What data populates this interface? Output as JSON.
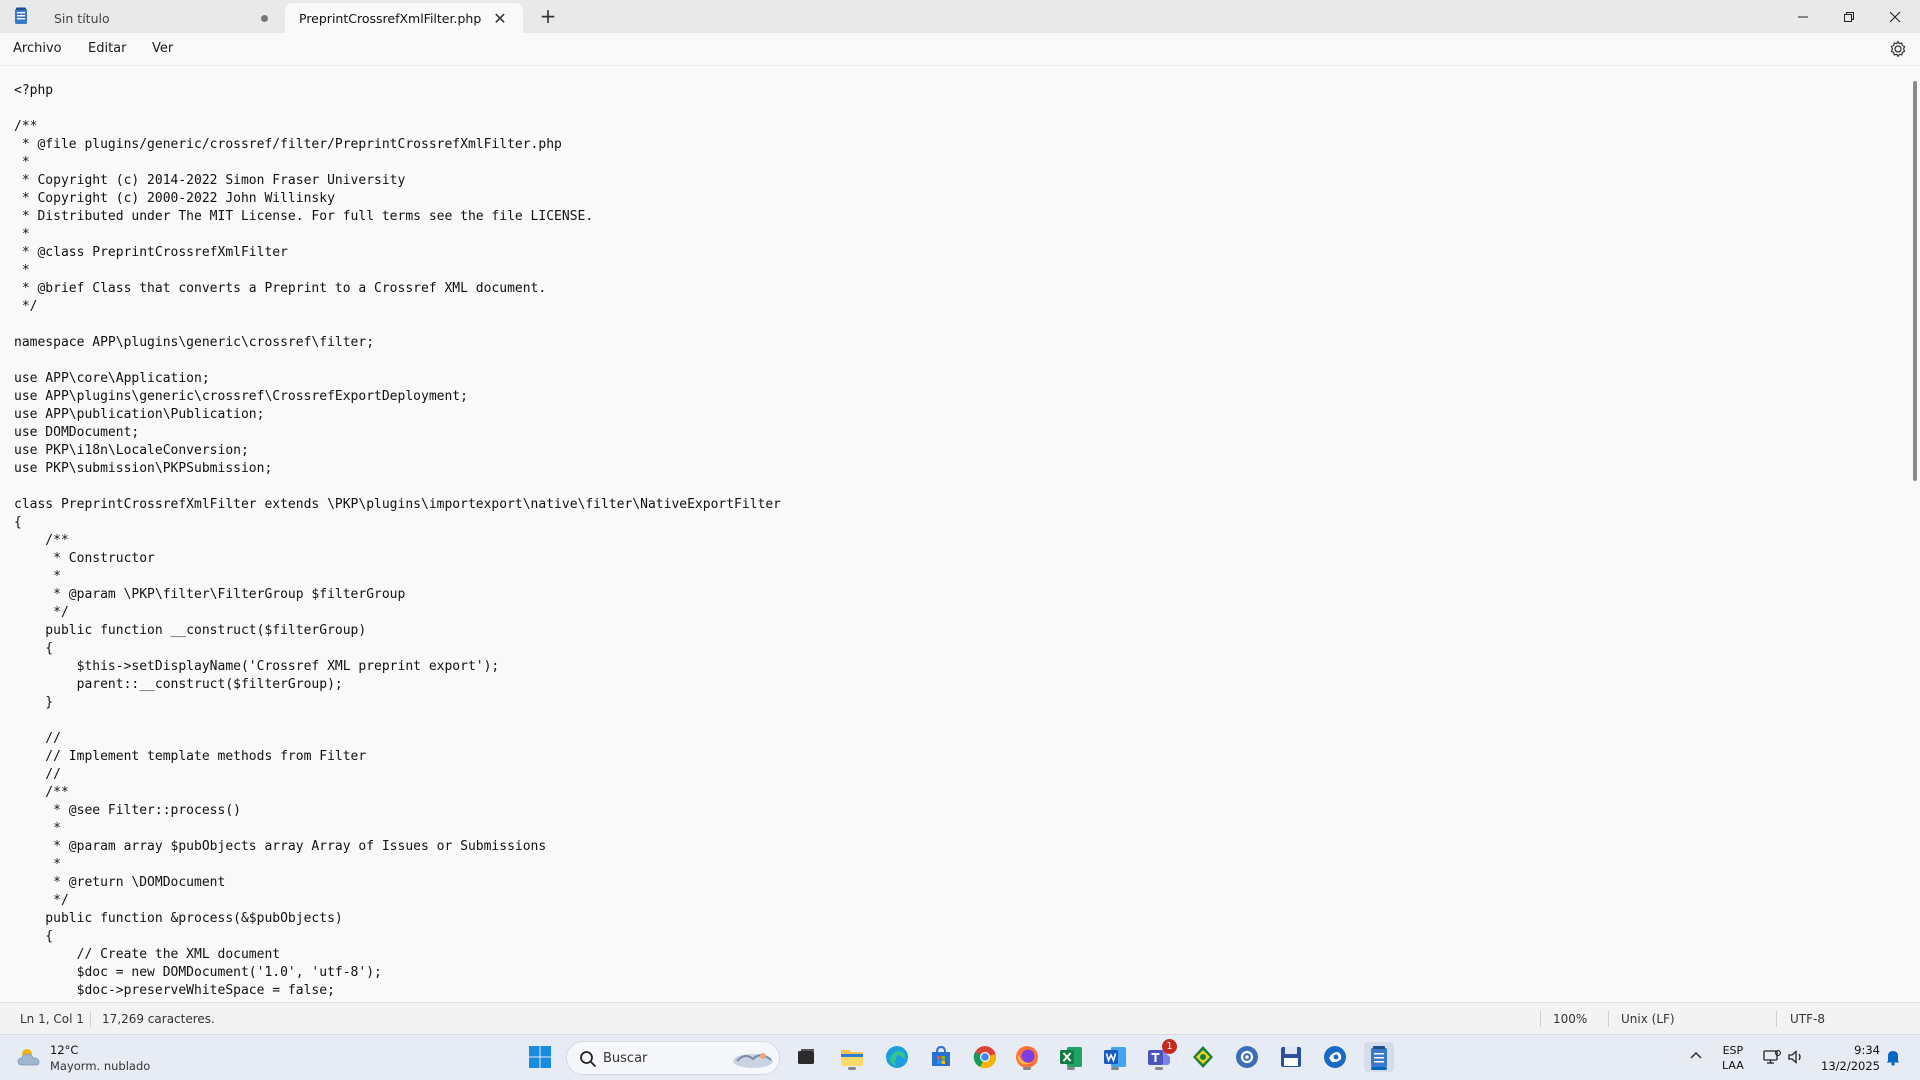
{
  "tabs": [
    {
      "label": "Sin título",
      "unsaved": true
    },
    {
      "label": "PreprintCrossrefXmlFilter.php",
      "active": true
    }
  ],
  "window": {
    "minimize_icon": "minimize-icon",
    "maximize_icon": "restore-icon",
    "close_icon": "close-icon"
  },
  "menu": {
    "file": "Archivo",
    "edit": "Editar",
    "view": "Ver"
  },
  "editor": {
    "lines": [
      "<?php",
      "",
      "/**",
      " * @file plugins/generic/crossref/filter/PreprintCrossrefXmlFilter.php",
      " *",
      " * Copyright (c) 2014-2022 Simon Fraser University",
      " * Copyright (c) 2000-2022 John Willinsky",
      " * Distributed under The MIT License. For full terms see the file LICENSE.",
      " *",
      " * @class PreprintCrossrefXmlFilter",
      " *",
      " * @brief Class that converts a Preprint to a Crossref XML document.",
      " */",
      "",
      "namespace APP\\plugins\\generic\\crossref\\filter;",
      "",
      "use APP\\core\\Application;",
      "use APP\\plugins\\generic\\crossref\\CrossrefExportDeployment;",
      "use APP\\publication\\Publication;",
      "use DOMDocument;",
      "use PKP\\i18n\\LocaleConversion;",
      "use PKP\\submission\\PKPSubmission;",
      "",
      "class PreprintCrossrefXmlFilter extends \\PKP\\plugins\\importexport\\native\\filter\\NativeExportFilter",
      "{",
      "    /**",
      "     * Constructor",
      "     *",
      "     * @param \\PKP\\filter\\FilterGroup $filterGroup",
      "     */",
      "    public function __construct($filterGroup)",
      "    {",
      "        $this->setDisplayName('Crossref XML preprint export');",
      "        parent::__construct($filterGroup);",
      "    }",
      "",
      "    //",
      "    // Implement template methods from Filter",
      "    //",
      "    /**",
      "     * @see Filter::process()",
      "     *",
      "     * @param array $pubObjects array Array of Issues or Submissions",
      "     *",
      "     * @return \\DOMDocument",
      "     */",
      "    public function &process(&$pubObjects)",
      "    {",
      "        // Create the XML document",
      "        $doc = new DOMDocument('1.0', 'utf-8');",
      "        $doc->preserveWhiteSpace = false;"
    ]
  },
  "status": {
    "position": "Ln 1, Col 1",
    "chars": "17,269 caracteres.",
    "zoom": "100%",
    "line_ending": "Unix (LF)",
    "encoding": "UTF-8"
  },
  "taskbar": {
    "weather_temp": "12°C",
    "weather_desc": "Mayorm. nublado",
    "search_placeholder": "Buscar",
    "teams_badge": "1",
    "lang_top": "ESP",
    "lang_bottom": "LAA",
    "time": "9:34",
    "date": "13/2/2025"
  },
  "colors": {
    "accent": "#0067c0",
    "badge": "#c42b1c"
  }
}
